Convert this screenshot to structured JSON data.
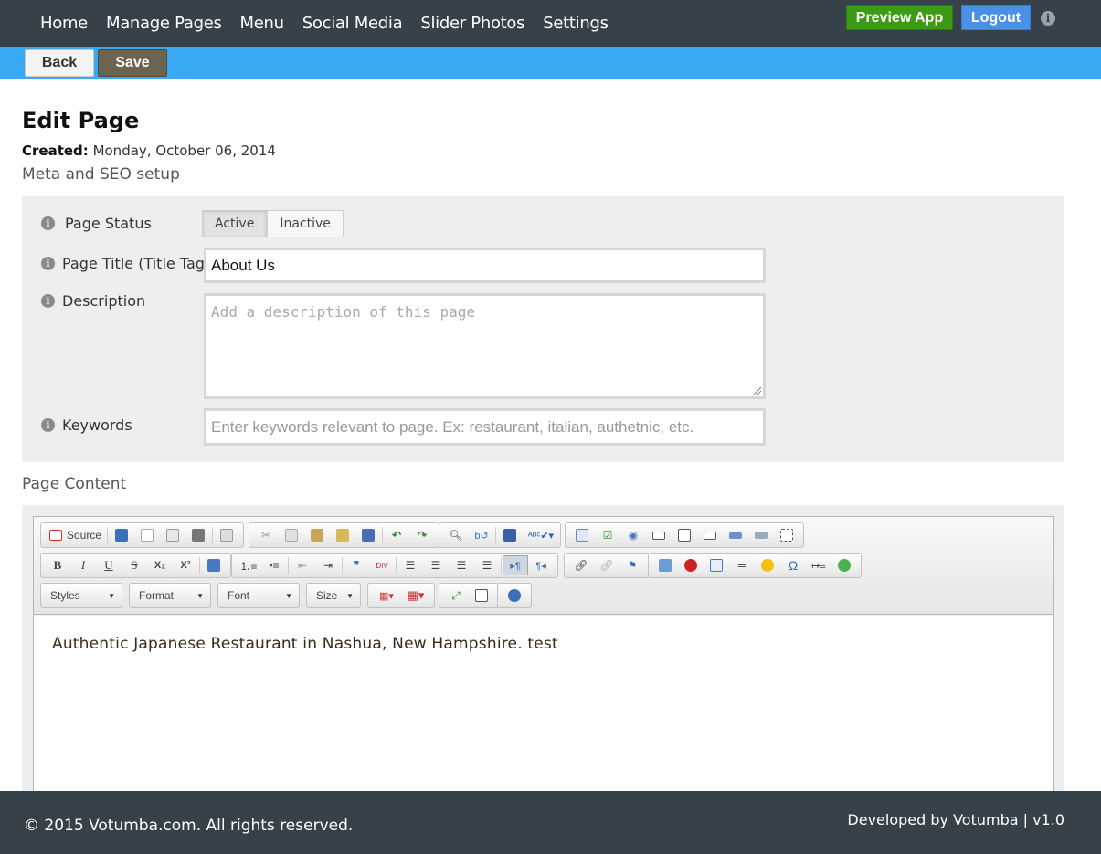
{
  "nav": {
    "items": [
      "Home",
      "Manage Pages",
      "Menu",
      "Social Media",
      "Slider Photos",
      "Settings"
    ],
    "preview_label": "Preview App",
    "logout_label": "Logout",
    "info_icon": "info-icon"
  },
  "actions": {
    "back_label": "Back",
    "save_label": "Save"
  },
  "page": {
    "title": "Edit Page",
    "created_label": "Created:",
    "created_value": "Monday, October 06, 2014",
    "meta_heading": "Meta and SEO setup",
    "content_heading": "Page Content"
  },
  "meta": {
    "status_label": "Page Status",
    "status_options": [
      "Active",
      "Inactive"
    ],
    "status_selected": "Active",
    "title_label": "Page Title (Title Tag)",
    "title_value": "About Us",
    "description_label": "Description",
    "description_placeholder": "Add a description of this page",
    "keywords_label": "Keywords",
    "keywords_placeholder": "Enter keywords relevant to page. Ex: restaurant, italian, authetnic, etc."
  },
  "editor": {
    "source_label": "Source",
    "combos": [
      "Styles",
      "Format",
      "Font",
      "Size"
    ],
    "content": "Authentic Japanese Restaurant in Nashua, New Hampshire. test"
  },
  "footer": {
    "copyright": "© 2015 Votumba.com. All rights reserved.",
    "developed": "Developed by Votumba | v1.0"
  },
  "colors": {
    "nav_bg": "#36414a",
    "action_bar": "#3aa9f5",
    "preview_btn": "#3c9a14",
    "logout_btn": "#4a8fe8",
    "save_btn": "#6b6450"
  }
}
